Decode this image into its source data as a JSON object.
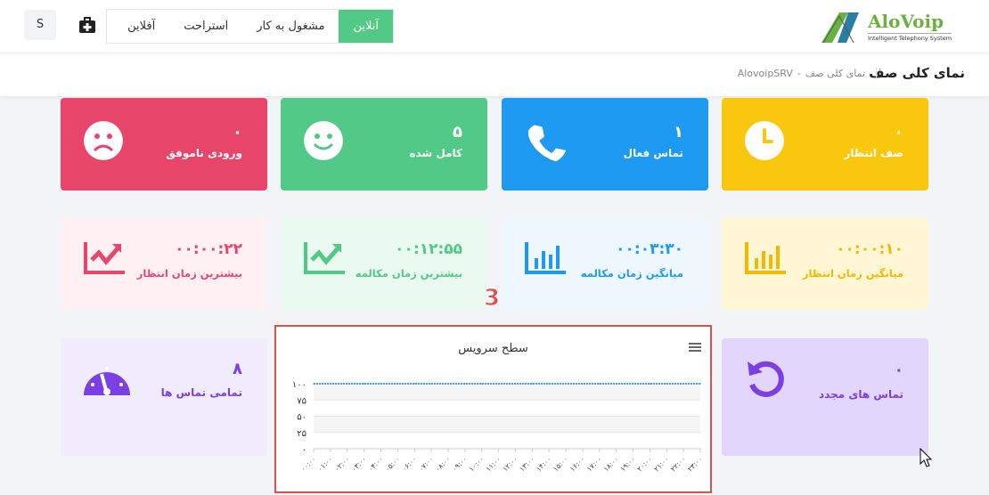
{
  "header": {
    "logo_brand": "AloVoip",
    "logo_tagline": "Intelligent Telephony System",
    "status_options": [
      {
        "label": "آنلاین",
        "active": true
      },
      {
        "label": "مشغول به کار",
        "active": false
      },
      {
        "label": "استراحت",
        "active": false
      },
      {
        "label": "آفلاین",
        "active": false
      }
    ],
    "avatar": "S"
  },
  "subheader": {
    "title": "نمای کلی صف",
    "breadcrumb": [
      "AlovoipSRV",
      "نمای کلی صف"
    ],
    "sep": "-"
  },
  "stats_top": [
    {
      "value": "۰",
      "label": "صف انتظار",
      "icon": "clock-icon",
      "color": "#f9c80e"
    },
    {
      "value": "۱",
      "label": "تماس فعال",
      "icon": "phone-icon",
      "color": "#1e9af2"
    },
    {
      "value": "۵",
      "label": "کامل شده",
      "icon": "smile-icon",
      "color": "#52c986"
    },
    {
      "value": "۰",
      "label": "ورودی ناموفق",
      "icon": "sad-icon",
      "color": "#e8456b"
    }
  ],
  "stats_time": [
    {
      "value": "۰۰:۰۰:۱۰",
      "label": "میانگین زمان انتظار",
      "icon": "bar-chart-icon",
      "color": "#f9c80e",
      "bg": "#fff6d6"
    },
    {
      "value": "۰۰:۰۳:۳۰",
      "label": "میانگین زمان مکالمه",
      "icon": "bar-chart-icon",
      "color": "#1e9af2",
      "bg": "#eef7fe"
    },
    {
      "value": "۰۰:۱۲:۵۵",
      "label": "بیشترین زمان مکالمه",
      "icon": "trend-up-icon",
      "color": "#52c986",
      "bg": "#eafaf1"
    },
    {
      "value": "۰۰:۰۰:۲۲",
      "label": "بیشترین زمان انتظار",
      "icon": "trend-up-icon",
      "color": "#e8456b",
      "bg": "#fff0f3"
    }
  ],
  "stats_bottom": [
    {
      "value": "۰",
      "label": "تماس های مجدد",
      "icon": "redo-icon",
      "color": "#7b3fe4",
      "bg": "#e2d6fc"
    },
    {
      "value": "۸",
      "label": "تمامی تماس ها",
      "icon": "gauge-icon",
      "color": "#7b3fe4",
      "bg": "#f1ecfd"
    }
  ],
  "annotation": "3",
  "chart_data": {
    "type": "line",
    "title": "سطح سرویس",
    "xlabel": "",
    "ylabel": "",
    "ylim": [
      0,
      100
    ],
    "yticks": [
      "۰",
      "۲۵",
      "۵۰",
      "۷۵",
      "۱۰۰"
    ],
    "categories": [
      "۰۰:۰۰",
      "۰۱:۰۰",
      "۰۲:۰۰",
      "۰۳:۰۰",
      "۰۴:۰۰",
      "۰۵:۰۰",
      "۰۶:۰۰",
      "۰۷:۰۰",
      "۰۸:۰۰",
      "۰۹:۰۰",
      "۱۰:۰۰",
      "۱۱:۰۰",
      "۱۲:۰۰",
      "۱۳:۰۰",
      "۱۴:۰۰",
      "۱۵:۰۰",
      "۱۶:۰۰",
      "۱۷:۰۰",
      "۱۸:۰۰",
      "۱۹:۰۰",
      "۲۰:۰۰",
      "۲۱:۰۰",
      "۲۲:۰۰",
      "۲۳:۰۰"
    ],
    "series": [
      {
        "name": "سطح سرویس",
        "values": [
          100,
          100,
          100,
          100,
          100,
          100,
          100,
          100,
          100,
          100,
          100,
          100,
          100,
          100,
          100,
          100,
          100,
          100,
          100,
          100,
          100,
          100,
          100,
          100
        ],
        "color": "#4a9fe8"
      }
    ]
  }
}
